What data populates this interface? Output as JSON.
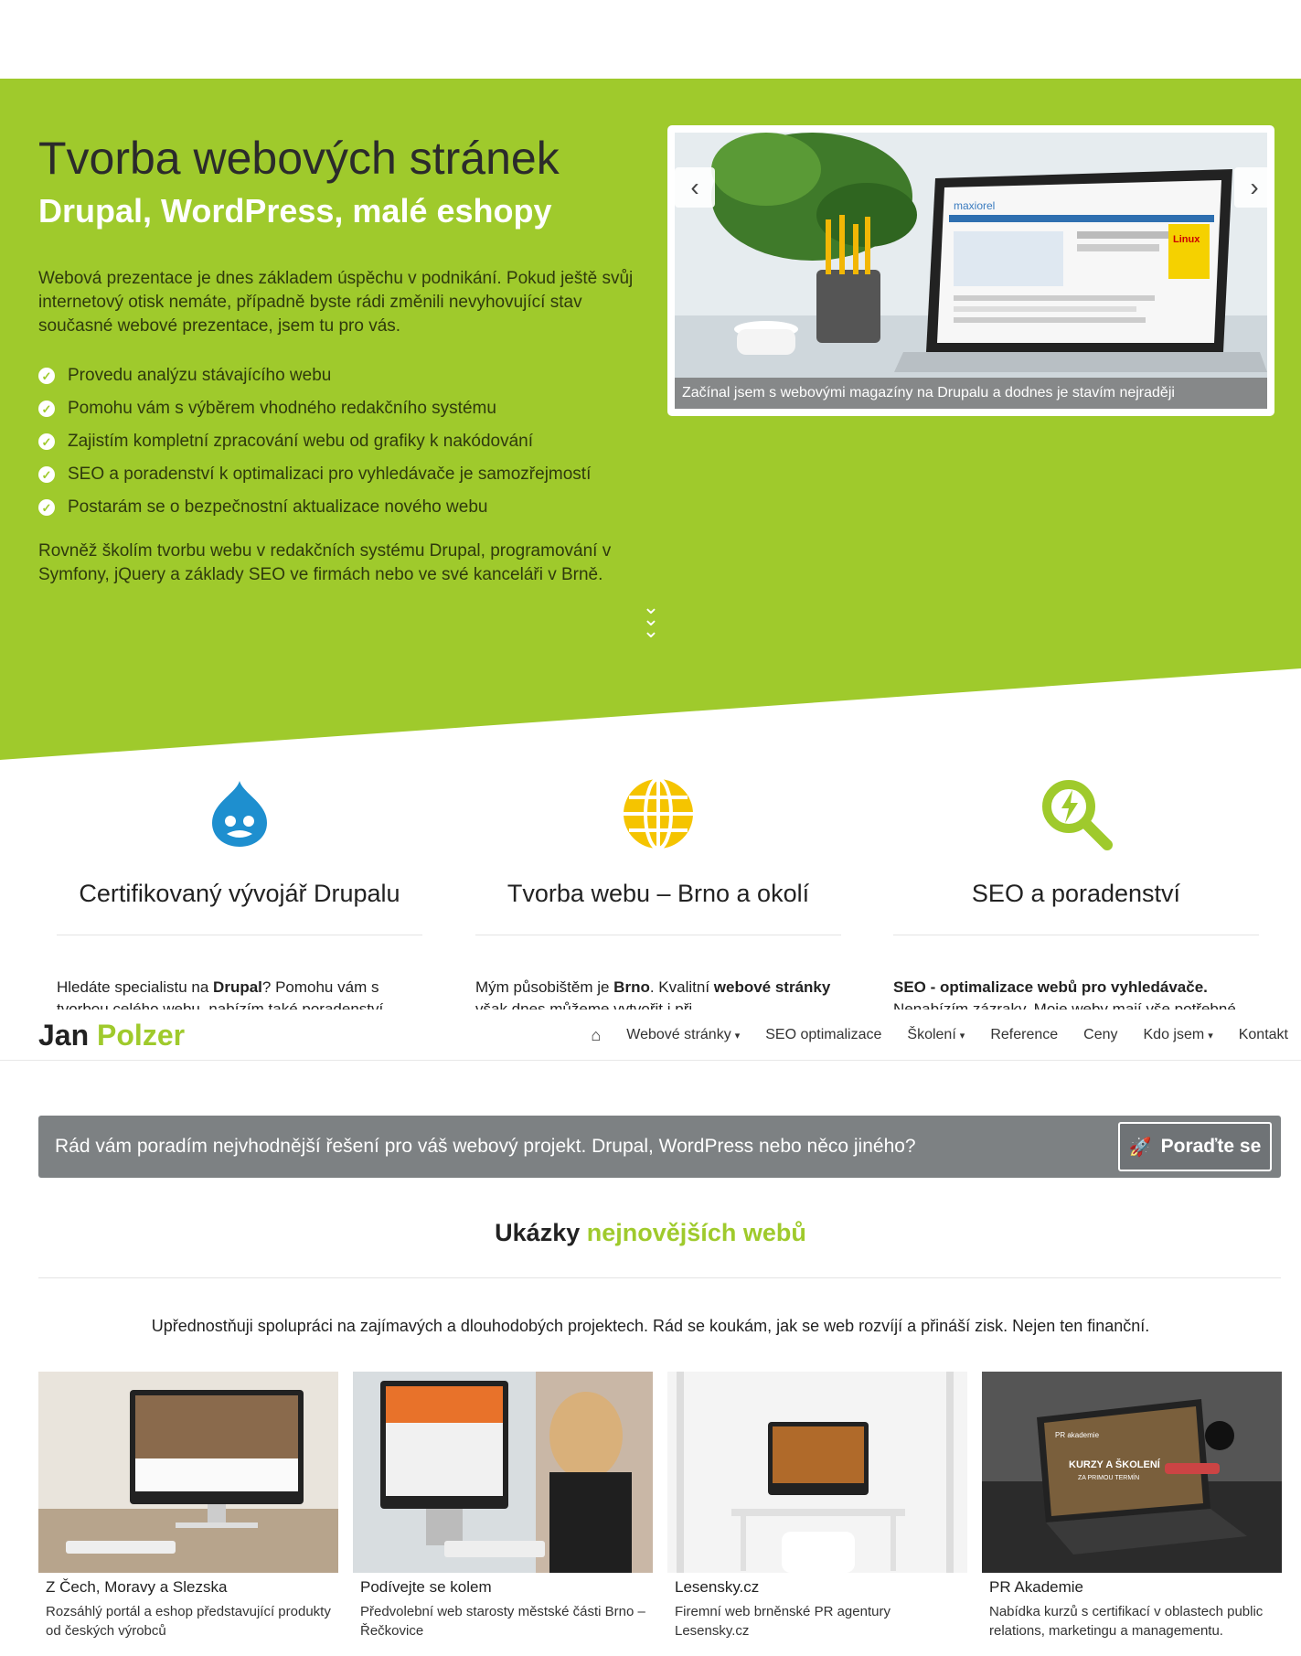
{
  "hero": {
    "title": "Tvorba webových stránek",
    "subtitle": "Drupal, WordPress, malé eshopy",
    "intro": "Webová prezentace je dnes základem úspěchu v podnikání. Pokud ještě svůj internetový otisk nemáte, případně byste rádi změnili nevyhovující stav současné webové prezentace, jsem tu pro vás.",
    "list": [
      "Provedu analýzu stávajícího webu",
      "Pomohu vám s výběrem vhodného redakčního systému",
      "Zajistím kompletní zpracování webu od grafiky k nakódování",
      "SEO a poradenství k optimalizaci pro vyhledávače je samozřejmostí",
      "Postarám se o bezpečnostní aktualizace nového webu"
    ],
    "outro": "Rovněž školím tvorbu webu v redakčních systému Drupal, programování v Symfony, jQuery a základy SEO ve firmách nebo ve své kanceláři v Brně.",
    "accent_color": "#9fca2c"
  },
  "slider": {
    "caption": "Začínal jsem s webovými magazíny na Drupalu a dodnes je stavím nejraději",
    "prev_icon": "chevron-left-icon",
    "next_icon": "chevron-right-icon",
    "screen": {
      "brand": "maxiorel",
      "badge": "Linux"
    }
  },
  "features": [
    {
      "title": "Certifikovaný vývojář Drupalu",
      "icon": "drupal-icon",
      "color": "#1e8fcf",
      "text_pre": "Hledáte specialistu na ",
      "text_bold": "Drupal",
      "text_post": "? Pomohu vám s tvorbou celého webu, nabízím také poradenství"
    },
    {
      "title": "Tvorba webu – Brno a okolí",
      "icon": "globe-icon",
      "color": "#f5c400",
      "text_pre": "Mým působištěm je ",
      "text_bold": "Brno",
      "text_mid": ". Kvalitní ",
      "text_bold2": "webové stránky",
      "text_post": " však dnes můžeme vytvořit i při"
    },
    {
      "title": "SEO a poradenství",
      "icon": "seo-magnifier-icon",
      "color": "#9fca2c",
      "text_bold": "SEO - optimalizace webů pro vyhledávače.",
      "text_post": " Nenabízím zázraky. Moje weby mají vše potřebné"
    }
  ],
  "header": {
    "logo_first": "Jan",
    "logo_second": "Polzer",
    "nav": {
      "home_icon": "home-icon",
      "items": [
        "Webové stránky",
        "SEO optimalizace",
        "Školení",
        "Reference",
        "Ceny",
        "Kdo jsem",
        "Kontakt"
      ]
    }
  },
  "cta": {
    "text": "Rád vám poradím nejvhodnější řešení pro váš webový projekt. Drupal, WordPress nebo něco jiného?",
    "button": "Poraďte se",
    "button_icon": "rocket-icon"
  },
  "showcase": {
    "title_plain": "Ukázky",
    "title_accent": "nejnovějších webů",
    "intro": "Upřednostňuji spolupráci na zajímavých a dlouhodobých projektech. Rád se koukám, jak se web rozvíjí a přináší zisk. Nejen ten finanční.",
    "cards": [
      {
        "title": "Z Čech, Moravy a Slezska",
        "desc": "Rozsáhlý portál a eshop představující produkty od českých výrobců"
      },
      {
        "title": "Podívejte se kolem",
        "desc": "Předvolební web starosty městské části Brno – Řečkovice"
      },
      {
        "title": "Lesensky.cz",
        "desc": "Firemní web brněnské PR agentury Lesensky.cz"
      },
      {
        "title": "PR Akademie",
        "desc": "Nabídka kurzů s certifikací v oblastech public relations, marketingu a managementu."
      }
    ],
    "card4_overlay": {
      "brand": "PR akademie",
      "headline": "KURZY A ŠKOLENÍ",
      "sub": "ZA PRIMOU TERMÍN"
    }
  }
}
